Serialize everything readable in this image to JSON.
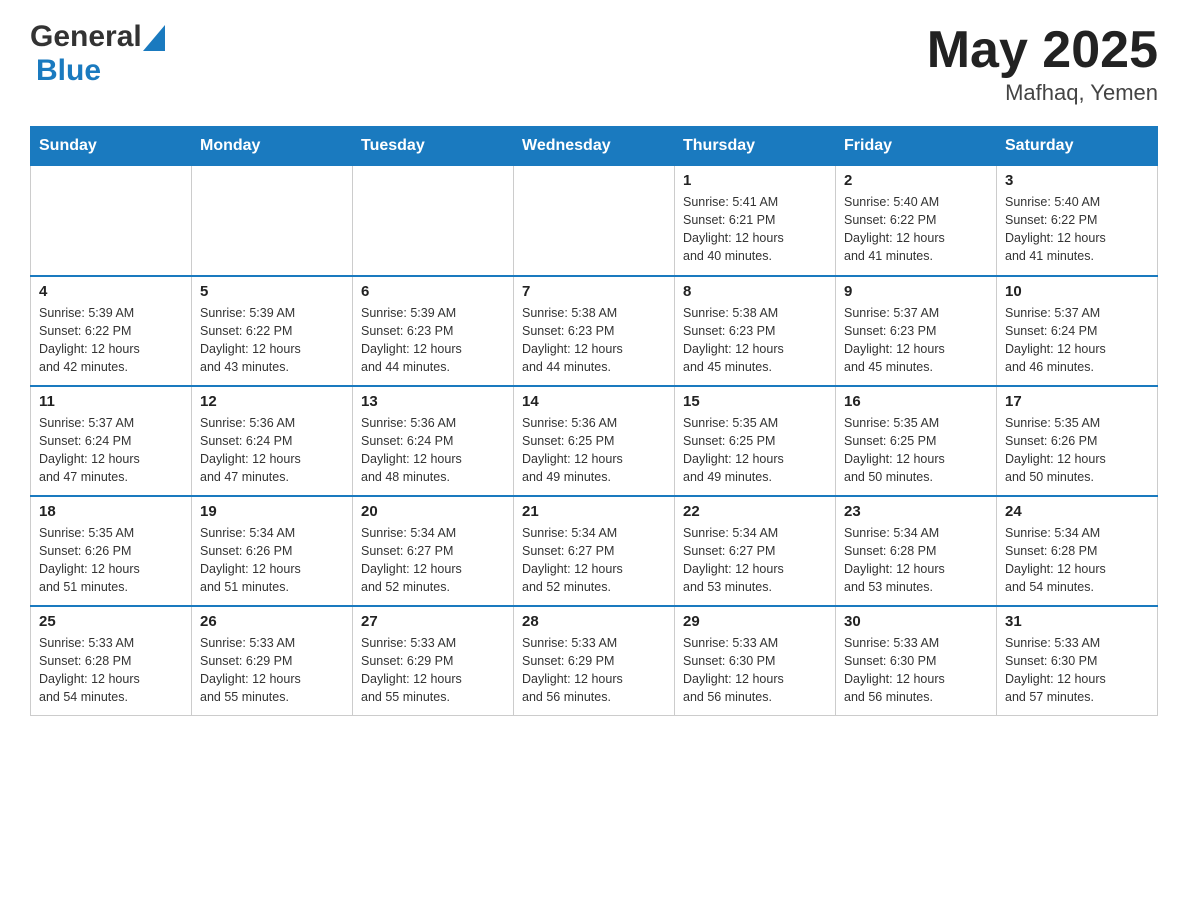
{
  "header": {
    "logo_general": "General",
    "logo_blue": "Blue",
    "title": "May 2025",
    "location": "Mafhaq, Yemen"
  },
  "weekdays": [
    "Sunday",
    "Monday",
    "Tuesday",
    "Wednesday",
    "Thursday",
    "Friday",
    "Saturday"
  ],
  "weeks": [
    [
      {
        "day": "",
        "info": ""
      },
      {
        "day": "",
        "info": ""
      },
      {
        "day": "",
        "info": ""
      },
      {
        "day": "",
        "info": ""
      },
      {
        "day": "1",
        "info": "Sunrise: 5:41 AM\nSunset: 6:21 PM\nDaylight: 12 hours\nand 40 minutes."
      },
      {
        "day": "2",
        "info": "Sunrise: 5:40 AM\nSunset: 6:22 PM\nDaylight: 12 hours\nand 41 minutes."
      },
      {
        "day": "3",
        "info": "Sunrise: 5:40 AM\nSunset: 6:22 PM\nDaylight: 12 hours\nand 41 minutes."
      }
    ],
    [
      {
        "day": "4",
        "info": "Sunrise: 5:39 AM\nSunset: 6:22 PM\nDaylight: 12 hours\nand 42 minutes."
      },
      {
        "day": "5",
        "info": "Sunrise: 5:39 AM\nSunset: 6:22 PM\nDaylight: 12 hours\nand 43 minutes."
      },
      {
        "day": "6",
        "info": "Sunrise: 5:39 AM\nSunset: 6:23 PM\nDaylight: 12 hours\nand 44 minutes."
      },
      {
        "day": "7",
        "info": "Sunrise: 5:38 AM\nSunset: 6:23 PM\nDaylight: 12 hours\nand 44 minutes."
      },
      {
        "day": "8",
        "info": "Sunrise: 5:38 AM\nSunset: 6:23 PM\nDaylight: 12 hours\nand 45 minutes."
      },
      {
        "day": "9",
        "info": "Sunrise: 5:37 AM\nSunset: 6:23 PM\nDaylight: 12 hours\nand 45 minutes."
      },
      {
        "day": "10",
        "info": "Sunrise: 5:37 AM\nSunset: 6:24 PM\nDaylight: 12 hours\nand 46 minutes."
      }
    ],
    [
      {
        "day": "11",
        "info": "Sunrise: 5:37 AM\nSunset: 6:24 PM\nDaylight: 12 hours\nand 47 minutes."
      },
      {
        "day": "12",
        "info": "Sunrise: 5:36 AM\nSunset: 6:24 PM\nDaylight: 12 hours\nand 47 minutes."
      },
      {
        "day": "13",
        "info": "Sunrise: 5:36 AM\nSunset: 6:24 PM\nDaylight: 12 hours\nand 48 minutes."
      },
      {
        "day": "14",
        "info": "Sunrise: 5:36 AM\nSunset: 6:25 PM\nDaylight: 12 hours\nand 49 minutes."
      },
      {
        "day": "15",
        "info": "Sunrise: 5:35 AM\nSunset: 6:25 PM\nDaylight: 12 hours\nand 49 minutes."
      },
      {
        "day": "16",
        "info": "Sunrise: 5:35 AM\nSunset: 6:25 PM\nDaylight: 12 hours\nand 50 minutes."
      },
      {
        "day": "17",
        "info": "Sunrise: 5:35 AM\nSunset: 6:26 PM\nDaylight: 12 hours\nand 50 minutes."
      }
    ],
    [
      {
        "day": "18",
        "info": "Sunrise: 5:35 AM\nSunset: 6:26 PM\nDaylight: 12 hours\nand 51 minutes."
      },
      {
        "day": "19",
        "info": "Sunrise: 5:34 AM\nSunset: 6:26 PM\nDaylight: 12 hours\nand 51 minutes."
      },
      {
        "day": "20",
        "info": "Sunrise: 5:34 AM\nSunset: 6:27 PM\nDaylight: 12 hours\nand 52 minutes."
      },
      {
        "day": "21",
        "info": "Sunrise: 5:34 AM\nSunset: 6:27 PM\nDaylight: 12 hours\nand 52 minutes."
      },
      {
        "day": "22",
        "info": "Sunrise: 5:34 AM\nSunset: 6:27 PM\nDaylight: 12 hours\nand 53 minutes."
      },
      {
        "day": "23",
        "info": "Sunrise: 5:34 AM\nSunset: 6:28 PM\nDaylight: 12 hours\nand 53 minutes."
      },
      {
        "day": "24",
        "info": "Sunrise: 5:34 AM\nSunset: 6:28 PM\nDaylight: 12 hours\nand 54 minutes."
      }
    ],
    [
      {
        "day": "25",
        "info": "Sunrise: 5:33 AM\nSunset: 6:28 PM\nDaylight: 12 hours\nand 54 minutes."
      },
      {
        "day": "26",
        "info": "Sunrise: 5:33 AM\nSunset: 6:29 PM\nDaylight: 12 hours\nand 55 minutes."
      },
      {
        "day": "27",
        "info": "Sunrise: 5:33 AM\nSunset: 6:29 PM\nDaylight: 12 hours\nand 55 minutes."
      },
      {
        "day": "28",
        "info": "Sunrise: 5:33 AM\nSunset: 6:29 PM\nDaylight: 12 hours\nand 56 minutes."
      },
      {
        "day": "29",
        "info": "Sunrise: 5:33 AM\nSunset: 6:30 PM\nDaylight: 12 hours\nand 56 minutes."
      },
      {
        "day": "30",
        "info": "Sunrise: 5:33 AM\nSunset: 6:30 PM\nDaylight: 12 hours\nand 56 minutes."
      },
      {
        "day": "31",
        "info": "Sunrise: 5:33 AM\nSunset: 6:30 PM\nDaylight: 12 hours\nand 57 minutes."
      }
    ]
  ]
}
